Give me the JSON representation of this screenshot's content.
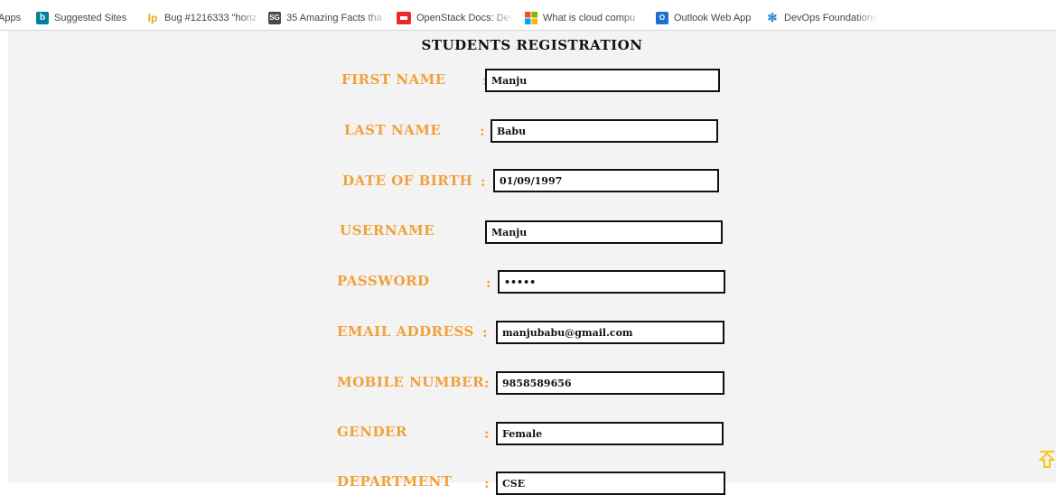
{
  "bookmarks": [
    {
      "label": "Apps",
      "icon": "apps-icon"
    },
    {
      "label": "Suggested Sites",
      "icon": "bing-icon",
      "color": "#00809d"
    },
    {
      "label": "Bug #1216333 \"horiz",
      "icon": "launchpad-icon",
      "color": "#f0a020"
    },
    {
      "label": "35 Amazing Facts tha",
      "icon": "sg-icon",
      "color": "#4a4a4a"
    },
    {
      "label": "OpenStack Docs: Dev",
      "icon": "openstack-icon",
      "color": "#ea2a2a"
    },
    {
      "label": "What is cloud compu",
      "icon": "microsoft-icon"
    },
    {
      "label": "Outlook Web App",
      "icon": "outlook-icon",
      "color": "#1f6fd0"
    },
    {
      "label": "DevOps Foundations",
      "icon": "snowflake-icon",
      "color": "#2a8ad6"
    }
  ],
  "form": {
    "title": "STUDENTS REGISTRATION",
    "colon": ":",
    "fields": {
      "first_name": {
        "label": "FIRST NAME",
        "value": "Manju"
      },
      "last_name": {
        "label": "LAST NAME",
        "value": "Babu"
      },
      "dob": {
        "label": "DATE OF BIRTH",
        "value": "01/09/1997"
      },
      "username": {
        "label": "USERNAME",
        "value": "Manju"
      },
      "password": {
        "label": "PASSWORD",
        "value": "•••••"
      },
      "email": {
        "label": "EMAIL ADDRESS",
        "value": "manjubabu@gmail.com"
      },
      "mobile": {
        "label": "MOBILE NUMBER",
        "value": "9858589656"
      },
      "gender": {
        "label": "GENDER",
        "value": "Female"
      },
      "department": {
        "label": "DEPARTMENT",
        "value": "CSE"
      }
    }
  },
  "colors": {
    "label": "#f2a13a",
    "background": "#f3f3f3",
    "scroll_top": "#f5c518"
  },
  "scroll_top_icon": "arrow-up-icon"
}
